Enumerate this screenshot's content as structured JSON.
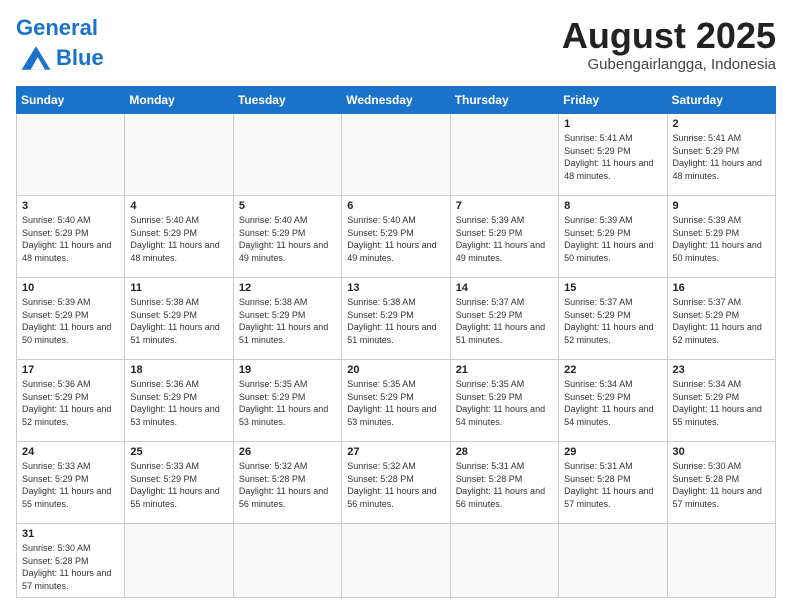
{
  "header": {
    "logo_general": "General",
    "logo_blue": "Blue",
    "title": "August 2025",
    "subtitle": "Gubengairlangga, Indonesia"
  },
  "weekdays": [
    "Sunday",
    "Monday",
    "Tuesday",
    "Wednesday",
    "Thursday",
    "Friday",
    "Saturday"
  ],
  "weeks": [
    [
      {
        "day": "",
        "info": ""
      },
      {
        "day": "",
        "info": ""
      },
      {
        "day": "",
        "info": ""
      },
      {
        "day": "",
        "info": ""
      },
      {
        "day": "",
        "info": ""
      },
      {
        "day": "1",
        "info": "Sunrise: 5:41 AM\nSunset: 5:29 PM\nDaylight: 11 hours and 48 minutes."
      },
      {
        "day": "2",
        "info": "Sunrise: 5:41 AM\nSunset: 5:29 PM\nDaylight: 11 hours and 48 minutes."
      }
    ],
    [
      {
        "day": "3",
        "info": "Sunrise: 5:40 AM\nSunset: 5:29 PM\nDaylight: 11 hours and 48 minutes."
      },
      {
        "day": "4",
        "info": "Sunrise: 5:40 AM\nSunset: 5:29 PM\nDaylight: 11 hours and 48 minutes."
      },
      {
        "day": "5",
        "info": "Sunrise: 5:40 AM\nSunset: 5:29 PM\nDaylight: 11 hours and 49 minutes."
      },
      {
        "day": "6",
        "info": "Sunrise: 5:40 AM\nSunset: 5:29 PM\nDaylight: 11 hours and 49 minutes."
      },
      {
        "day": "7",
        "info": "Sunrise: 5:39 AM\nSunset: 5:29 PM\nDaylight: 11 hours and 49 minutes."
      },
      {
        "day": "8",
        "info": "Sunrise: 5:39 AM\nSunset: 5:29 PM\nDaylight: 11 hours and 50 minutes."
      },
      {
        "day": "9",
        "info": "Sunrise: 5:39 AM\nSunset: 5:29 PM\nDaylight: 11 hours and 50 minutes."
      }
    ],
    [
      {
        "day": "10",
        "info": "Sunrise: 5:39 AM\nSunset: 5:29 PM\nDaylight: 11 hours and 50 minutes."
      },
      {
        "day": "11",
        "info": "Sunrise: 5:38 AM\nSunset: 5:29 PM\nDaylight: 11 hours and 51 minutes."
      },
      {
        "day": "12",
        "info": "Sunrise: 5:38 AM\nSunset: 5:29 PM\nDaylight: 11 hours and 51 minutes."
      },
      {
        "day": "13",
        "info": "Sunrise: 5:38 AM\nSunset: 5:29 PM\nDaylight: 11 hours and 51 minutes."
      },
      {
        "day": "14",
        "info": "Sunrise: 5:37 AM\nSunset: 5:29 PM\nDaylight: 11 hours and 51 minutes."
      },
      {
        "day": "15",
        "info": "Sunrise: 5:37 AM\nSunset: 5:29 PM\nDaylight: 11 hours and 52 minutes."
      },
      {
        "day": "16",
        "info": "Sunrise: 5:37 AM\nSunset: 5:29 PM\nDaylight: 11 hours and 52 minutes."
      }
    ],
    [
      {
        "day": "17",
        "info": "Sunrise: 5:36 AM\nSunset: 5:29 PM\nDaylight: 11 hours and 52 minutes."
      },
      {
        "day": "18",
        "info": "Sunrise: 5:36 AM\nSunset: 5:29 PM\nDaylight: 11 hours and 53 minutes."
      },
      {
        "day": "19",
        "info": "Sunrise: 5:35 AM\nSunset: 5:29 PM\nDaylight: 11 hours and 53 minutes."
      },
      {
        "day": "20",
        "info": "Sunrise: 5:35 AM\nSunset: 5:29 PM\nDaylight: 11 hours and 53 minutes."
      },
      {
        "day": "21",
        "info": "Sunrise: 5:35 AM\nSunset: 5:29 PM\nDaylight: 11 hours and 54 minutes."
      },
      {
        "day": "22",
        "info": "Sunrise: 5:34 AM\nSunset: 5:29 PM\nDaylight: 11 hours and 54 minutes."
      },
      {
        "day": "23",
        "info": "Sunrise: 5:34 AM\nSunset: 5:29 PM\nDaylight: 11 hours and 55 minutes."
      }
    ],
    [
      {
        "day": "24",
        "info": "Sunrise: 5:33 AM\nSunset: 5:29 PM\nDaylight: 11 hours and 55 minutes."
      },
      {
        "day": "25",
        "info": "Sunrise: 5:33 AM\nSunset: 5:29 PM\nDaylight: 11 hours and 55 minutes."
      },
      {
        "day": "26",
        "info": "Sunrise: 5:32 AM\nSunset: 5:28 PM\nDaylight: 11 hours and 56 minutes."
      },
      {
        "day": "27",
        "info": "Sunrise: 5:32 AM\nSunset: 5:28 PM\nDaylight: 11 hours and 56 minutes."
      },
      {
        "day": "28",
        "info": "Sunrise: 5:31 AM\nSunset: 5:28 PM\nDaylight: 11 hours and 56 minutes."
      },
      {
        "day": "29",
        "info": "Sunrise: 5:31 AM\nSunset: 5:28 PM\nDaylight: 11 hours and 57 minutes."
      },
      {
        "day": "30",
        "info": "Sunrise: 5:30 AM\nSunset: 5:28 PM\nDaylight: 11 hours and 57 minutes."
      }
    ],
    [
      {
        "day": "31",
        "info": "Sunrise: 5:30 AM\nSunset: 5:28 PM\nDaylight: 11 hours and 57 minutes."
      },
      {
        "day": "",
        "info": ""
      },
      {
        "day": "",
        "info": ""
      },
      {
        "day": "",
        "info": ""
      },
      {
        "day": "",
        "info": ""
      },
      {
        "day": "",
        "info": ""
      },
      {
        "day": "",
        "info": ""
      }
    ]
  ]
}
